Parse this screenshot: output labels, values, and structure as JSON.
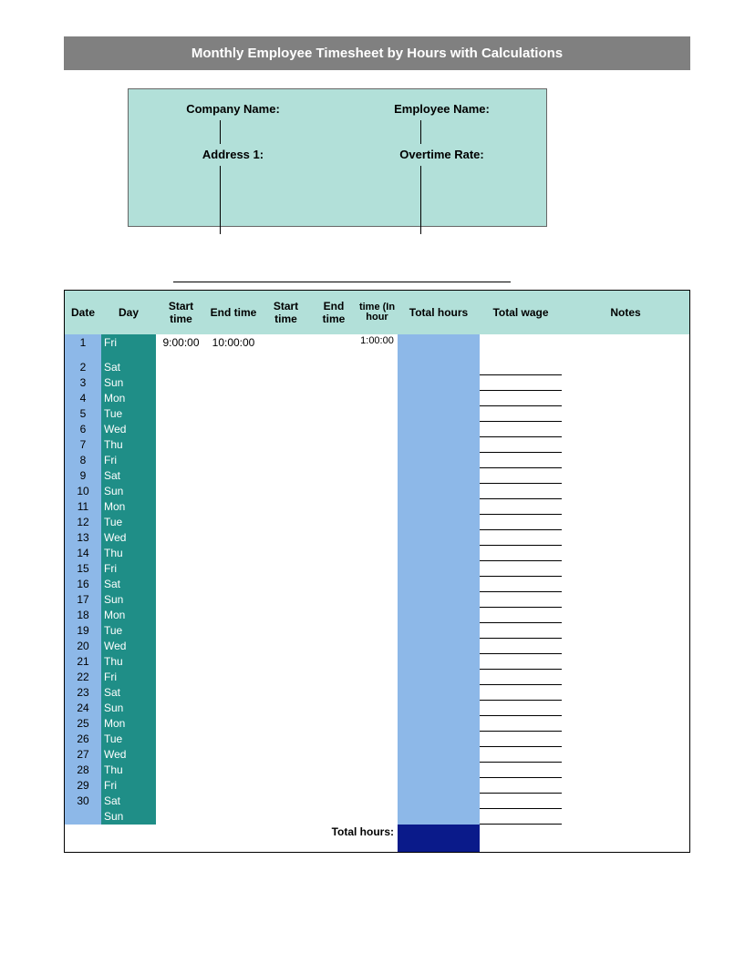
{
  "title": "Monthly Employee Timesheet by Hours with Calculations",
  "info": {
    "companyLabel": "Company Name:",
    "employeeLabel": "Employee Name:",
    "addressLabel": "Address 1:",
    "overtimeLabel": "Overtime Rate:"
  },
  "headers": {
    "date": "Date",
    "day": "Day",
    "start1": "Start time",
    "end1": "End time",
    "start2": "Start time",
    "end2": "End time",
    "timein": "time (In hour",
    "thours": "Total hours",
    "twage": "Total wage",
    "notes": "Notes"
  },
  "rows": [
    {
      "date": "1",
      "day": "Fri",
      "start": "9:00:00",
      "end": "10:00:00",
      "timein": "1:00:00"
    },
    {
      "date": "2",
      "day": "Sat"
    },
    {
      "date": "3",
      "day": "Sun"
    },
    {
      "date": "4",
      "day": "Mon"
    },
    {
      "date": "5",
      "day": "Tue"
    },
    {
      "date": "6",
      "day": "Wed"
    },
    {
      "date": "7",
      "day": "Thu"
    },
    {
      "date": "8",
      "day": "Fri"
    },
    {
      "date": "9",
      "day": "Sat"
    },
    {
      "date": "10",
      "day": "Sun"
    },
    {
      "date": "11",
      "day": "Mon"
    },
    {
      "date": "12",
      "day": "Tue"
    },
    {
      "date": "13",
      "day": "Wed"
    },
    {
      "date": "14",
      "day": "Thu"
    },
    {
      "date": "15",
      "day": "Fri"
    },
    {
      "date": "16",
      "day": "Sat"
    },
    {
      "date": "17",
      "day": "Sun"
    },
    {
      "date": "18",
      "day": "Mon"
    },
    {
      "date": "19",
      "day": "Tue"
    },
    {
      "date": "20",
      "day": "Wed"
    },
    {
      "date": "21",
      "day": "Thu"
    },
    {
      "date": "22",
      "day": "Fri"
    },
    {
      "date": "23",
      "day": "Sat"
    },
    {
      "date": "24",
      "day": "Sun"
    },
    {
      "date": "25",
      "day": "Mon"
    },
    {
      "date": "26",
      "day": "Tue"
    },
    {
      "date": "27",
      "day": "Wed"
    },
    {
      "date": "28",
      "day": "Thu"
    },
    {
      "date": "29",
      "day": "Fri"
    },
    {
      "date": "30",
      "day": "Sat"
    },
    {
      "date": "",
      "day": "Sun"
    }
  ],
  "totalLabel": "Total hours:"
}
